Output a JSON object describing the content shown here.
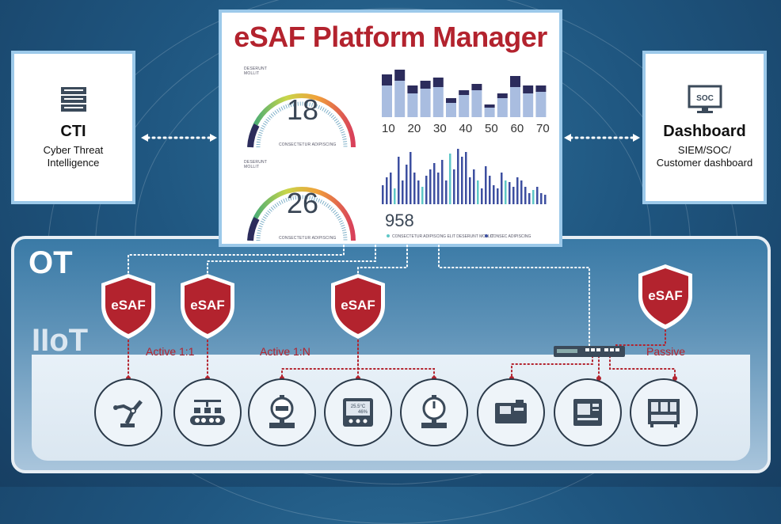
{
  "platform": {
    "title": "eSAF Platform Manager",
    "gauge1": {
      "value": "18",
      "label_top": "DESERUNT MOLLIT",
      "label_bottom": "CONSECTETUR ADIPISCING"
    },
    "gauge2": {
      "value": "26",
      "label_top": "DESERUNT MOLLIT",
      "label_bottom": "CONSECTETUR ADIPISCING"
    },
    "bar_ticks": [
      "10",
      "20",
      "30",
      "40",
      "50",
      "60",
      "70"
    ],
    "counter": "958",
    "legend1": "CONSECTETUR ADIPISCING ELIT DESERUNT MOLLIT",
    "legend2": "CONSEC ADIPISCING"
  },
  "cti": {
    "title": "CTI",
    "subtitle_line1": "Cyber Threat",
    "subtitle_line2": "Intelligence"
  },
  "dashboard": {
    "title": "Dashboard",
    "subtitle_line1": "SIEM/SOC/",
    "subtitle_line2": "Customer dashboard",
    "monitor_text": "SOC"
  },
  "zones": {
    "ot": "OT",
    "iiot": "IIoT"
  },
  "modes": {
    "active_1_1": "Active 1:1",
    "active_1_n": "Active 1:N",
    "passive": "Passive"
  },
  "shield_label": "eSAF",
  "hmi_readout": {
    "temp": "25.5°C",
    "humidity": "46%"
  },
  "colors": {
    "brand_red": "#b3232e",
    "frame_blue": "#9cc9ea",
    "background": "#1f5680",
    "bar_dark": "#2c2c5c",
    "bar_light": "#a9bde0"
  },
  "devices": [
    "robot-arm-icon",
    "conveyor-icon",
    "flow-meter-icon",
    "hmi-panel-icon",
    "valve-gauge-icon",
    "cnc-machine-icon",
    "machining-center-icon",
    "control-cabinet-icon"
  ]
}
